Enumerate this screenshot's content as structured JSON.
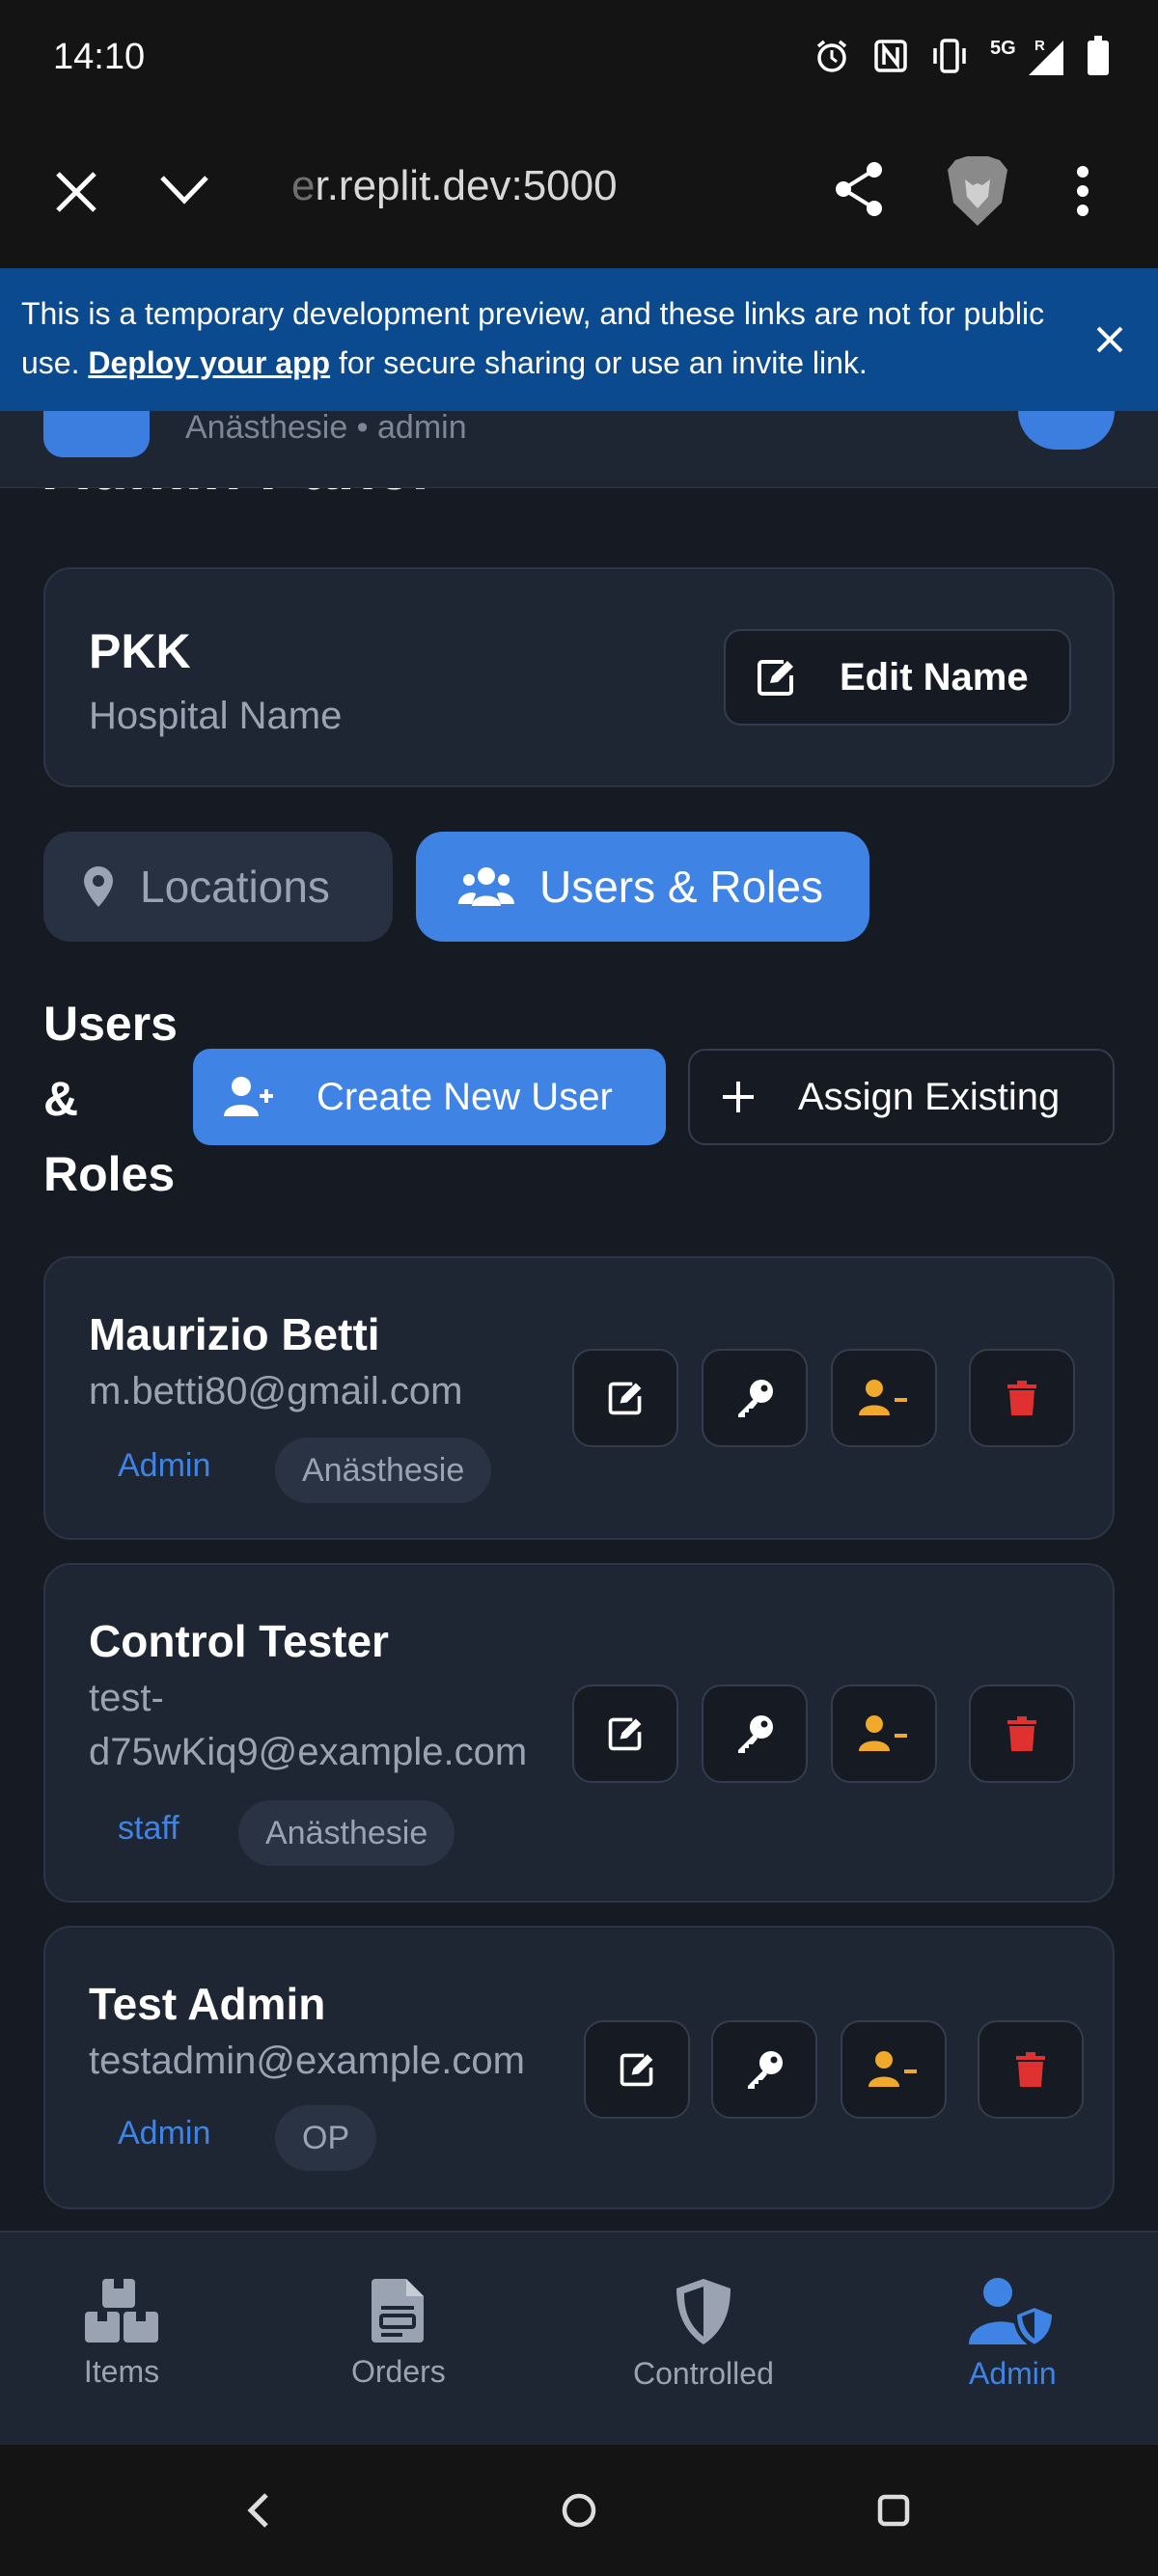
{
  "status": {
    "time": "14:10",
    "network": "5G",
    "roaming": "R"
  },
  "browser": {
    "url_faded": "e",
    "url": "r.replit.dev:5000"
  },
  "banner": {
    "text_before": "This is a temporary development preview, and these links are not for public use.",
    "link": "Deploy your app",
    "text_after": "for secure sharing or use an invite link."
  },
  "header": {
    "subtitle": "Anästhesie • admin"
  },
  "page": {
    "title": "Admin Panel"
  },
  "hospital": {
    "name": "PKK",
    "label": "Hospital Name",
    "edit_label": "Edit Name"
  },
  "tabs": {
    "locations": "Locations",
    "users": "Users & Roles"
  },
  "section": {
    "title_1": "Users",
    "title_2": "&",
    "title_3": "Roles",
    "create_label": "Create New User",
    "assign_label": "Assign Existing"
  },
  "users": [
    {
      "name": "Maurizio Betti",
      "email": "m.betti80@gmail.com",
      "role": "Admin",
      "department": "Anästhesie"
    },
    {
      "name": "Control Tester",
      "email_1": "test-",
      "email_2": "d75wKiq9@example.com",
      "role": "staff",
      "department": "Anästhesie"
    },
    {
      "name": "Test Admin",
      "email": "testadmin@example.com",
      "role": "Admin",
      "department": "OP"
    }
  ],
  "nav": {
    "items": "Items",
    "orders": "Orders",
    "controlled": "Controlled",
    "admin": "Admin"
  },
  "colors": {
    "accent": "#3f84e4",
    "warning": "#f0a92a",
    "danger": "#e03131",
    "banner": "#0b4a8f"
  }
}
